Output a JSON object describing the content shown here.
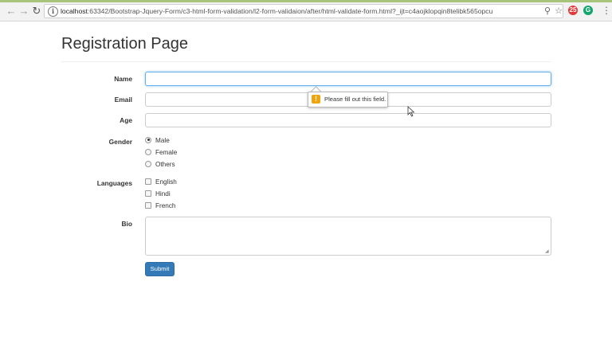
{
  "browser": {
    "url_host": "localhost",
    "url_rest": ":63342/Bootstrap-Jquery-Form/c3-html-form-validation/l2-form-validaion/after/html-validate-form.html?_ijt=c4aojklopqin8telibk565opcu",
    "extensions": [
      {
        "name": "adblock-icon",
        "label": "25",
        "color": "#e23a3a"
      },
      {
        "name": "grammarly-icon",
        "label": "G",
        "color": "#15a36e"
      }
    ]
  },
  "page": {
    "title": "Registration Page"
  },
  "form": {
    "name_label": "Name",
    "name_value": "",
    "email_label": "Email",
    "email_value": "",
    "age_label": "Age",
    "age_value": "",
    "gender_label": "Gender",
    "gender_options": [
      "Male",
      "Female",
      "Others"
    ],
    "gender_selected": "Male",
    "languages_label": "Languages",
    "language_options": [
      "English",
      "Hindi",
      "French"
    ],
    "bio_label": "Bio",
    "bio_value": "",
    "submit_label": "Submit"
  },
  "validation": {
    "message": "Please fill out this field.",
    "icon": "!",
    "color": "#f0a30a"
  },
  "colors": {
    "primary": "#337ab7",
    "focus": "#66afe9"
  }
}
